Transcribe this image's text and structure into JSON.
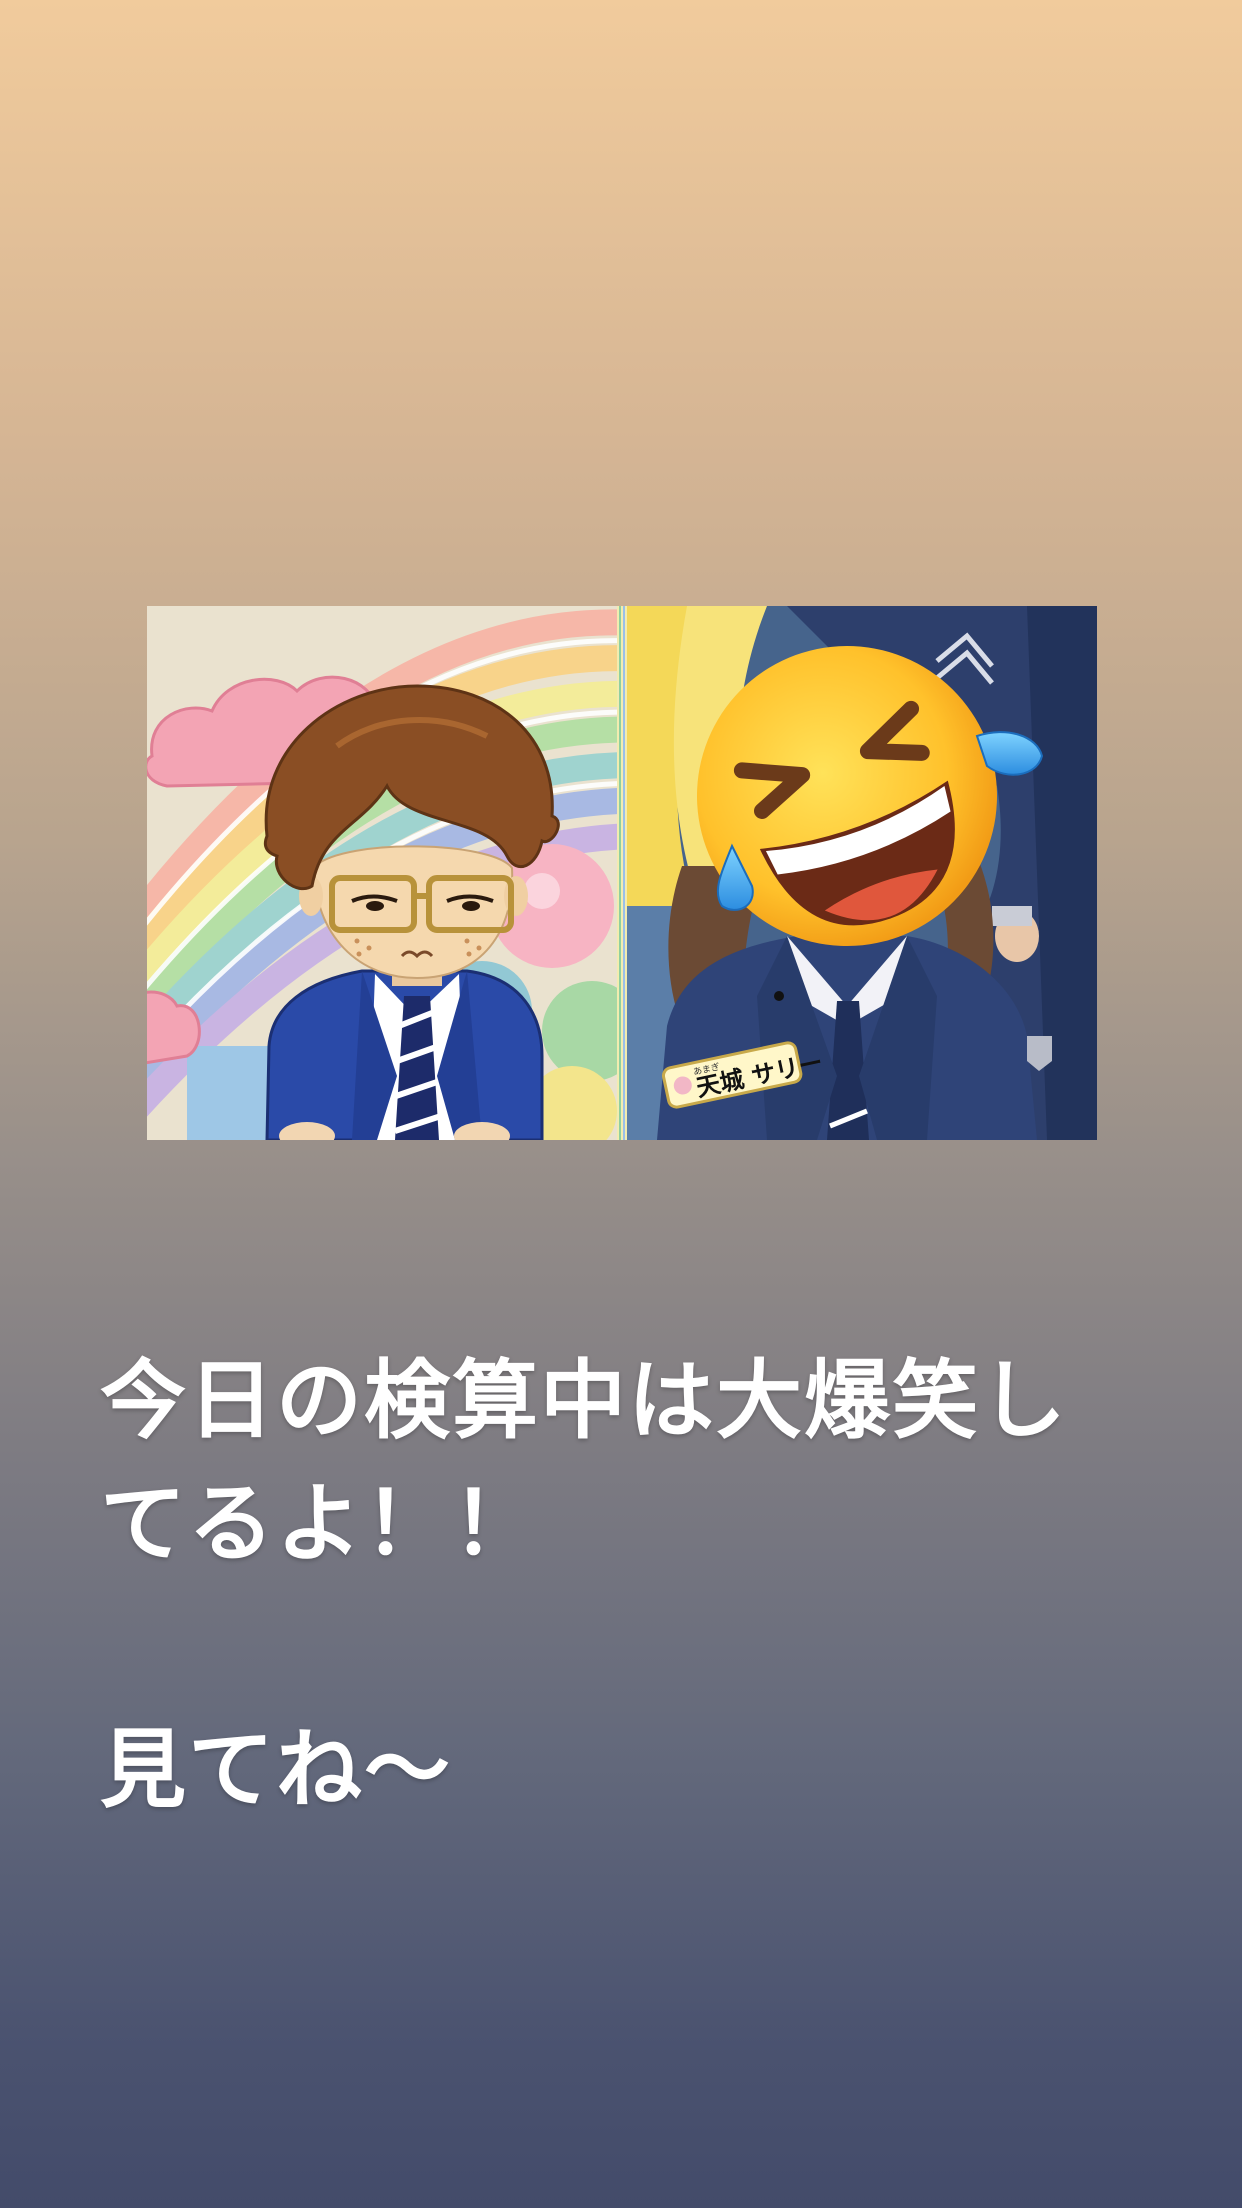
{
  "story": {
    "image": {
      "left_panel": "anime-character-illustration",
      "right_panel": "person-with-face-covered-by-emoji",
      "emoji": "rolling-on-the-floor-laughing",
      "name_badge": {
        "ruby": "あまぎ",
        "text": "天城 サリー"
      }
    },
    "caption": {
      "line1": "今日の検算中は大爆笑し",
      "line2": "てるよ！！",
      "line3": "見てね〜"
    }
  }
}
